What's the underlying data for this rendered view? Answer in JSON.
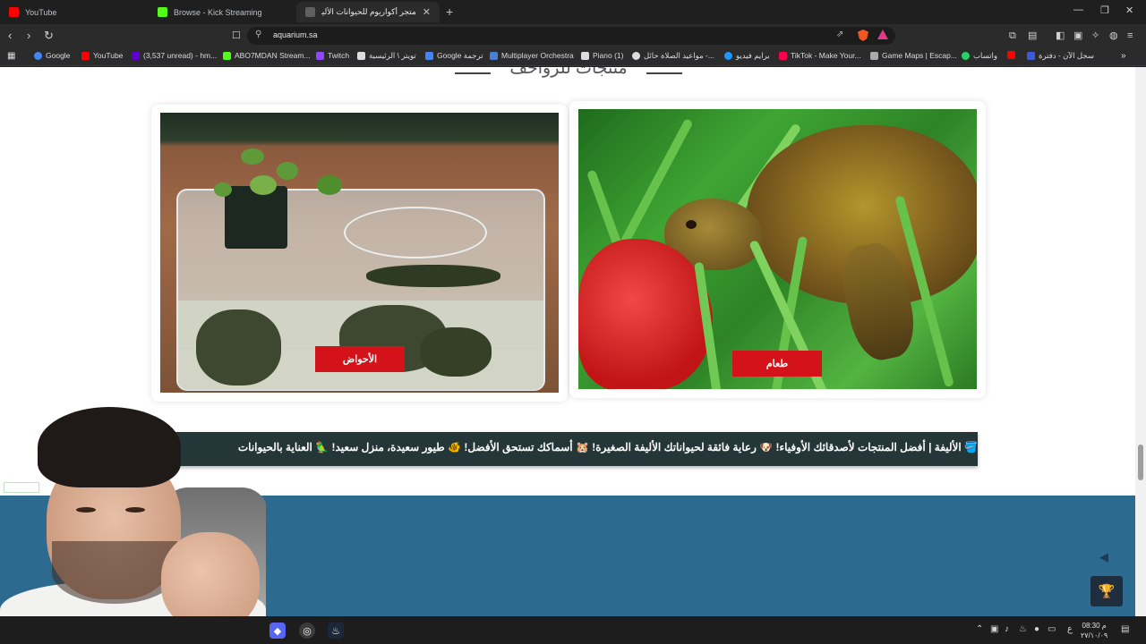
{
  "browser": {
    "tabs": [
      {
        "label": "YouTube",
        "favicon_color": "#ff0000",
        "active": false
      },
      {
        "label": "Browse - Kick Streaming",
        "favicon_color": "#53fc18",
        "active": false
      },
      {
        "label": "متجر أكواريوم للحيوانات الأليفة –",
        "favicon_color": "#5f5f5f",
        "active": true
      }
    ],
    "new_tab_glyph": "+",
    "window_controls": [
      "—",
      "❐",
      "✕"
    ],
    "url": "aquarium.sa",
    "bookmarks": [
      {
        "label": "Google",
        "color": "#4285f4"
      },
      {
        "label": "YouTube",
        "color": "#ff0000"
      },
      {
        "label": "(3,537 unread) - hm...",
        "color": "#6001d2"
      },
      {
        "label": "ABO7MDAN Stream...",
        "color": "#53fc18"
      },
      {
        "label": "Twitch",
        "color": "#9146ff"
      },
      {
        "label": "تويتر \\ الرئيسية",
        "color": "#dddddd"
      },
      {
        "label": "Google ترجمة",
        "color": "#4285f4"
      },
      {
        "label": "Multiplayer Orchestra",
        "color": "#4a7fd4"
      },
      {
        "label": "Piano (1)",
        "color": "#dddddd"
      },
      {
        "label": "مواعيد الصلاة حائل -...",
        "color": "#dddddd"
      },
      {
        "label": "برايم فيديو",
        "color": "#1a98ff"
      },
      {
        "label": "TikTok - Make Your...",
        "color": "#ff0050"
      },
      {
        "label": "Game Maps | Escap...",
        "color": "#aaaaaa"
      },
      {
        "label": "واتساب",
        "color": "#25d366"
      },
      {
        "label": "سجل الآن - دفترة",
        "color": "#3b5bdb"
      }
    ]
  },
  "page": {
    "section_title": "منتجات للزواحف",
    "cards": [
      {
        "button_label": "الأحواض",
        "image": "aquarium-tank-photo"
      },
      {
        "button_label": "طعام",
        "image": "turtle-eating-strawberry-photo"
      }
    ],
    "marquee_text": "🪣 الأليفة  |  أفضل المنتجات لأصدقائك الأوفياء! 🐶 رعاية فائقة لحيواناتك الأليفة الصغيرة! 🐹 أسماكك تستحق الأفضل! 🐠 طيور سعيدة، منزل سعيد! 🦜 العناية بالحيوانات",
    "colors": {
      "button_red": "#d4121a",
      "banner_dark": "#243638",
      "footer_blue": "#2d6a8f"
    }
  },
  "taskbar": {
    "apps": [
      "discord",
      "chrome",
      "steam"
    ],
    "clock_time": "08:30 م",
    "clock_date": "٢٧/١٠/٠٩"
  }
}
